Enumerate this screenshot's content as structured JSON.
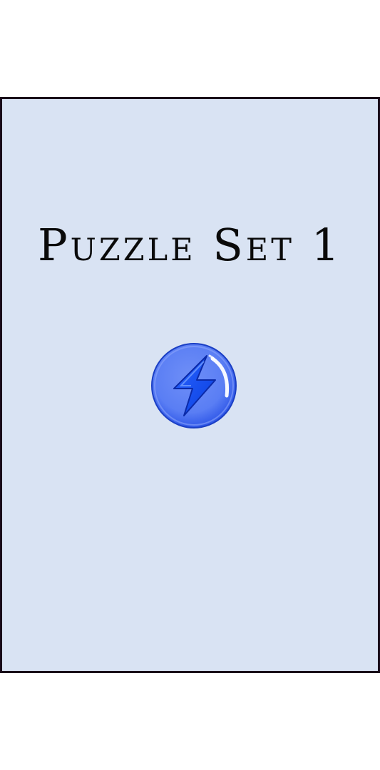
{
  "puzzle_set": {
    "title": "Puzzle Set 1",
    "start_icon": "lightning-bolt-icon"
  },
  "colors": {
    "card_background": "#d9e3f3",
    "card_border": "#1a0a1a",
    "orb_blue": "#3a66f0",
    "bolt_blue": "#1f5cff"
  }
}
